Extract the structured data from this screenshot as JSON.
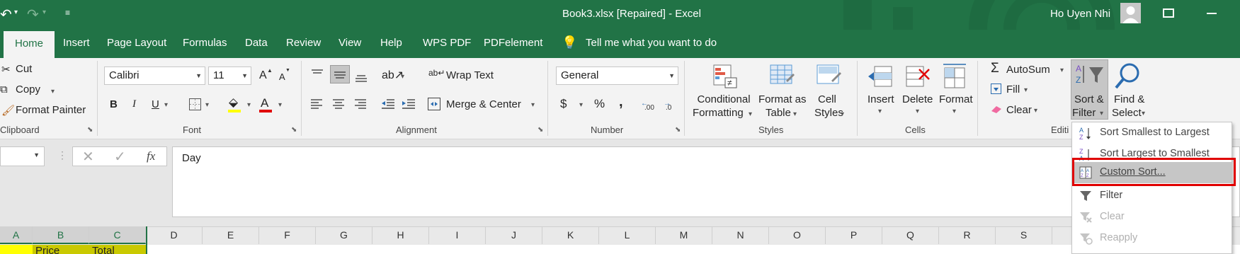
{
  "titlebar": {
    "title": "Book3.xlsx [Repaired]  -  Excel",
    "user": "Ho Uyen Nhi"
  },
  "tabs": [
    "Home",
    "Insert",
    "Page Layout",
    "Formulas",
    "Data",
    "Review",
    "View",
    "Help",
    "WPS PDF",
    "PDFelement"
  ],
  "tell_me": "Tell me what you want to do",
  "clipboard": {
    "cut": "Cut",
    "copy": "Copy",
    "format_painter": "Format Painter",
    "label": "Clipboard"
  },
  "font": {
    "name": "Calibri",
    "size": "11",
    "label": "Font",
    "bold": "B",
    "italic": "I",
    "underline": "U",
    "grow": "A",
    "shrink": "A",
    "color_letter": "A"
  },
  "alignment": {
    "wrap_text": "Wrap Text",
    "merge_center": "Merge & Center",
    "label": "Alignment"
  },
  "number": {
    "format": "General",
    "label": "Number",
    "currency": "$",
    "percent": "%",
    "comma": ",",
    "inc_dec": ".00",
    "dec_dec": ".0"
  },
  "styles": {
    "conditional": [
      "Conditional",
      "Formatting"
    ],
    "format_table": [
      "Format as",
      "Table"
    ],
    "cell_styles": [
      "Cell",
      "Styles"
    ],
    "label": "Styles"
  },
  "cells": {
    "insert": "Insert",
    "delete": "Delete",
    "format": "Format",
    "label": "Cells"
  },
  "editing": {
    "autosum": "AutoSum",
    "fill": "Fill",
    "clear": "Clear",
    "sort_filter": [
      "Sort &",
      "Filter"
    ],
    "find_select": [
      "Find &",
      "Select"
    ],
    "label": "Editi"
  },
  "formula_bar": {
    "fx": "fx",
    "content": "Day"
  },
  "columns": [
    "A",
    "B",
    "C",
    "D",
    "E",
    "F",
    "G",
    "H",
    "I",
    "J",
    "K",
    "L",
    "M",
    "N",
    "O",
    "P",
    "Q",
    "R",
    "S"
  ],
  "row1": {
    "b": "Price",
    "c": "Total"
  },
  "sort_menu": [
    {
      "label": "Sort Smallest to Largest",
      "icon": "sort-ascending-icon",
      "disabled": false
    },
    {
      "label": "Sort Largest to Smallest",
      "icon": "sort-descending-icon",
      "disabled": false
    },
    {
      "label": "Custom Sort...",
      "icon": "custom-sort-icon",
      "disabled": false
    },
    {
      "label": "Filter",
      "icon": "filter-icon",
      "disabled": false
    },
    {
      "label": "Clear",
      "icon": "clear-filter-icon",
      "disabled": true
    },
    {
      "label": "Reapply",
      "icon": "reapply-icon",
      "disabled": true
    }
  ],
  "colors": {
    "excel_green": "#217346",
    "highlight_red": "#e00000",
    "header_yellow": "#ffff00",
    "cell_olive": "#c9c900"
  }
}
